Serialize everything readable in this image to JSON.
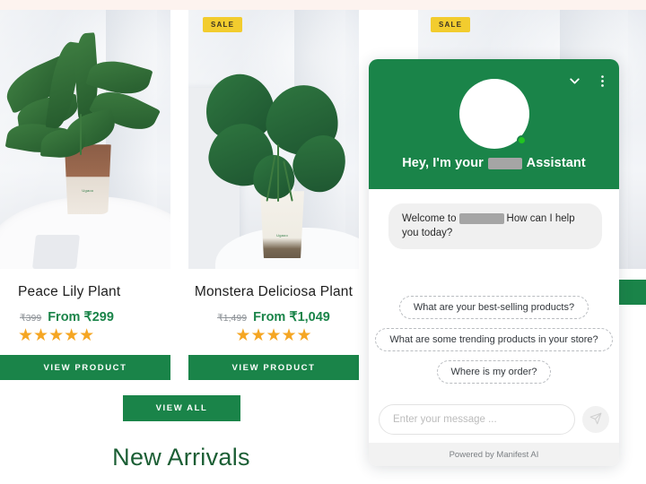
{
  "store": {
    "products": [
      {
        "name": "Peace Lily Plant",
        "price_old": "₹399",
        "price_new": "From ₹299",
        "stars": "★★★★★",
        "sale_badge": "",
        "cta": "VIEW PRODUCT",
        "pot_brand": "Ugaoo"
      },
      {
        "name": "Monstera Deliciosa Plant",
        "price_old": "₹1,499",
        "price_new": "From ₹1,049",
        "stars": "★★★★★",
        "sale_badge": "SALE",
        "cta": "VIEW PRODUCT",
        "pot_brand": "Ugaoo"
      },
      {
        "name": "",
        "price_old": "",
        "price_new": "",
        "stars": "",
        "sale_badge": "SALE",
        "cta": "",
        "pot_brand": ""
      }
    ],
    "view_all_label": "VIEW ALL",
    "section_heading": "New Arrivals",
    "accent_green": "#1a8449",
    "sale_yellow": "#f2cc2e",
    "star_color": "#f5a623"
  },
  "chat_widget": {
    "greeting_prefix": "Hey, I'm your",
    "greeting_suffix": "Assistant",
    "welcome_prefix": "Welcome to",
    "welcome_suffix": "How can I help you today?",
    "minimize_icon": "chevron-down-icon",
    "menu_icon": "kebab-menu-icon",
    "avatar_icon": "assistant-avatar",
    "status": "online",
    "suggestions": [
      "What are your best-selling products?",
      "What are some trending products in your store?",
      "Where is my order?"
    ],
    "input_placeholder": "Enter your message ...",
    "input_value": "",
    "send_icon": "send-paper-plane-icon",
    "footer": "Powered by Manifest AI",
    "header_color": "#1a8449"
  }
}
